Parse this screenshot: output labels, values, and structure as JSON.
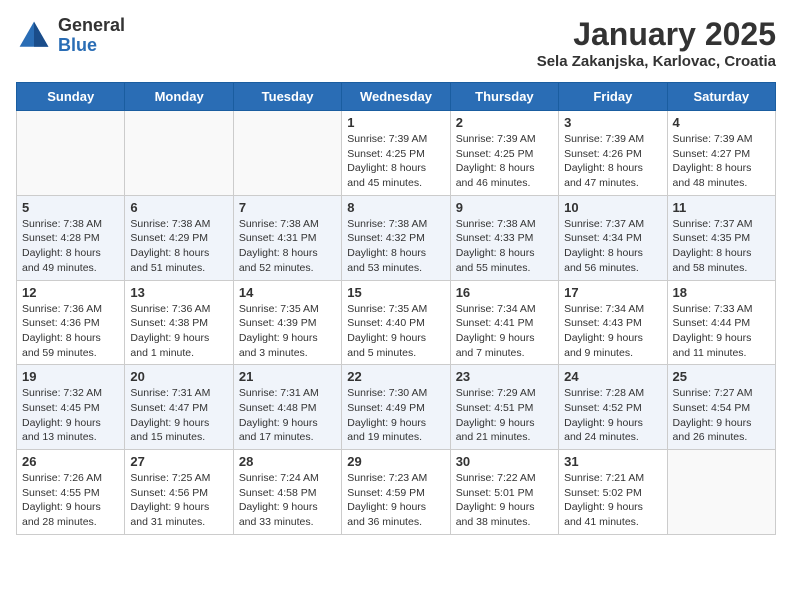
{
  "header": {
    "logo_general": "General",
    "logo_blue": "Blue",
    "title": "January 2025",
    "subtitle": "Sela Zakanjska, Karlovac, Croatia"
  },
  "weekdays": [
    "Sunday",
    "Monday",
    "Tuesday",
    "Wednesday",
    "Thursday",
    "Friday",
    "Saturday"
  ],
  "weeks": [
    [
      {
        "day": "",
        "info": ""
      },
      {
        "day": "",
        "info": ""
      },
      {
        "day": "",
        "info": ""
      },
      {
        "day": "1",
        "info": "Sunrise: 7:39 AM\nSunset: 4:25 PM\nDaylight: 8 hours and 45 minutes."
      },
      {
        "day": "2",
        "info": "Sunrise: 7:39 AM\nSunset: 4:25 PM\nDaylight: 8 hours and 46 minutes."
      },
      {
        "day": "3",
        "info": "Sunrise: 7:39 AM\nSunset: 4:26 PM\nDaylight: 8 hours and 47 minutes."
      },
      {
        "day": "4",
        "info": "Sunrise: 7:39 AM\nSunset: 4:27 PM\nDaylight: 8 hours and 48 minutes."
      }
    ],
    [
      {
        "day": "5",
        "info": "Sunrise: 7:38 AM\nSunset: 4:28 PM\nDaylight: 8 hours and 49 minutes."
      },
      {
        "day": "6",
        "info": "Sunrise: 7:38 AM\nSunset: 4:29 PM\nDaylight: 8 hours and 51 minutes."
      },
      {
        "day": "7",
        "info": "Sunrise: 7:38 AM\nSunset: 4:31 PM\nDaylight: 8 hours and 52 minutes."
      },
      {
        "day": "8",
        "info": "Sunrise: 7:38 AM\nSunset: 4:32 PM\nDaylight: 8 hours and 53 minutes."
      },
      {
        "day": "9",
        "info": "Sunrise: 7:38 AM\nSunset: 4:33 PM\nDaylight: 8 hours and 55 minutes."
      },
      {
        "day": "10",
        "info": "Sunrise: 7:37 AM\nSunset: 4:34 PM\nDaylight: 8 hours and 56 minutes."
      },
      {
        "day": "11",
        "info": "Sunrise: 7:37 AM\nSunset: 4:35 PM\nDaylight: 8 hours and 58 minutes."
      }
    ],
    [
      {
        "day": "12",
        "info": "Sunrise: 7:36 AM\nSunset: 4:36 PM\nDaylight: 8 hours and 59 minutes."
      },
      {
        "day": "13",
        "info": "Sunrise: 7:36 AM\nSunset: 4:38 PM\nDaylight: 9 hours and 1 minute."
      },
      {
        "day": "14",
        "info": "Sunrise: 7:35 AM\nSunset: 4:39 PM\nDaylight: 9 hours and 3 minutes."
      },
      {
        "day": "15",
        "info": "Sunrise: 7:35 AM\nSunset: 4:40 PM\nDaylight: 9 hours and 5 minutes."
      },
      {
        "day": "16",
        "info": "Sunrise: 7:34 AM\nSunset: 4:41 PM\nDaylight: 9 hours and 7 minutes."
      },
      {
        "day": "17",
        "info": "Sunrise: 7:34 AM\nSunset: 4:43 PM\nDaylight: 9 hours and 9 minutes."
      },
      {
        "day": "18",
        "info": "Sunrise: 7:33 AM\nSunset: 4:44 PM\nDaylight: 9 hours and 11 minutes."
      }
    ],
    [
      {
        "day": "19",
        "info": "Sunrise: 7:32 AM\nSunset: 4:45 PM\nDaylight: 9 hours and 13 minutes."
      },
      {
        "day": "20",
        "info": "Sunrise: 7:31 AM\nSunset: 4:47 PM\nDaylight: 9 hours and 15 minutes."
      },
      {
        "day": "21",
        "info": "Sunrise: 7:31 AM\nSunset: 4:48 PM\nDaylight: 9 hours and 17 minutes."
      },
      {
        "day": "22",
        "info": "Sunrise: 7:30 AM\nSunset: 4:49 PM\nDaylight: 9 hours and 19 minutes."
      },
      {
        "day": "23",
        "info": "Sunrise: 7:29 AM\nSunset: 4:51 PM\nDaylight: 9 hours and 21 minutes."
      },
      {
        "day": "24",
        "info": "Sunrise: 7:28 AM\nSunset: 4:52 PM\nDaylight: 9 hours and 24 minutes."
      },
      {
        "day": "25",
        "info": "Sunrise: 7:27 AM\nSunset: 4:54 PM\nDaylight: 9 hours and 26 minutes."
      }
    ],
    [
      {
        "day": "26",
        "info": "Sunrise: 7:26 AM\nSunset: 4:55 PM\nDaylight: 9 hours and 28 minutes."
      },
      {
        "day": "27",
        "info": "Sunrise: 7:25 AM\nSunset: 4:56 PM\nDaylight: 9 hours and 31 minutes."
      },
      {
        "day": "28",
        "info": "Sunrise: 7:24 AM\nSunset: 4:58 PM\nDaylight: 9 hours and 33 minutes."
      },
      {
        "day": "29",
        "info": "Sunrise: 7:23 AM\nSunset: 4:59 PM\nDaylight: 9 hours and 36 minutes."
      },
      {
        "day": "30",
        "info": "Sunrise: 7:22 AM\nSunset: 5:01 PM\nDaylight: 9 hours and 38 minutes."
      },
      {
        "day": "31",
        "info": "Sunrise: 7:21 AM\nSunset: 5:02 PM\nDaylight: 9 hours and 41 minutes."
      },
      {
        "day": "",
        "info": ""
      }
    ]
  ]
}
